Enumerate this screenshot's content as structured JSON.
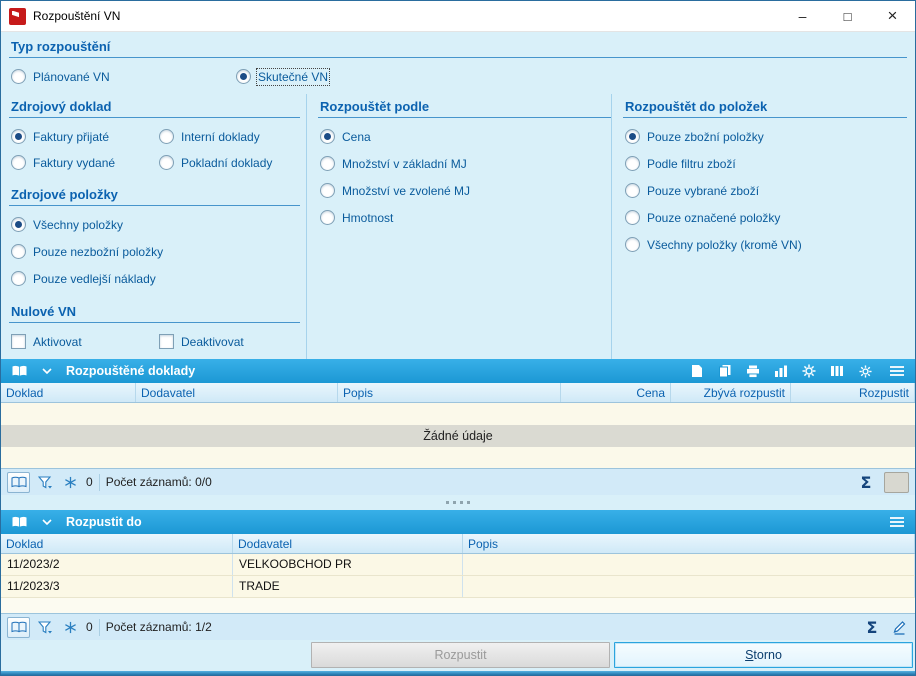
{
  "window": {
    "title": "Rozpouštění VN",
    "controls": {
      "minimize": "–",
      "maximize": "□",
      "close": "×"
    }
  },
  "panel": {
    "typ": {
      "heading": "Typ rozpouštění",
      "options": [
        {
          "label": "Plánované VN",
          "checked": false
        },
        {
          "label": "Skutečné VN",
          "checked": true
        }
      ]
    },
    "zdrojovy_doklad": {
      "heading": "Zdrojový doklad",
      "options": [
        {
          "label": "Faktury přijaté",
          "checked": true
        },
        {
          "label": "Interní doklady",
          "checked": false
        },
        {
          "label": "Faktury vydané",
          "checked": false
        },
        {
          "label": "Pokladní doklady",
          "checked": false
        }
      ]
    },
    "zdrojove_polozky": {
      "heading": "Zdrojové položky",
      "options": [
        {
          "label": "Všechny položky",
          "checked": true
        },
        {
          "label": "Pouze nezbožní položky",
          "checked": false
        },
        {
          "label": "Pouze vedlejší náklady",
          "checked": false
        }
      ]
    },
    "nulove_vn": {
      "heading": "Nulové VN",
      "options": [
        {
          "label": "Aktivovat",
          "checked": false
        },
        {
          "label": "Deaktivovat",
          "checked": false
        }
      ]
    },
    "rozpoustet_podle": {
      "heading": "Rozpouštět podle",
      "options": [
        {
          "label": "Cena",
          "checked": true
        },
        {
          "label": "Množství v základní MJ",
          "checked": false
        },
        {
          "label": "Množství ve zvolené MJ",
          "checked": false
        },
        {
          "label": "Hmotnost",
          "checked": false
        }
      ]
    },
    "rozpoustet_do": {
      "heading": "Rozpouštět do položek",
      "options": [
        {
          "label": "Pouze zbožní položky",
          "checked": true
        },
        {
          "label": "Podle filtru zboží",
          "checked": false
        },
        {
          "label": "Pouze vybrané zboží",
          "checked": false
        },
        {
          "label": "Pouze označené položky",
          "checked": false
        },
        {
          "label": "Všechny položky (kromě VN)",
          "checked": false
        }
      ]
    }
  },
  "grid1": {
    "title": "Rozpouštěné doklady",
    "toolbar_icons": [
      "open-book",
      "chevron-down",
      "new-document",
      "copy",
      "print",
      "chart",
      "actions-gear",
      "columns",
      "settings-gear",
      "menu"
    ],
    "columns": [
      "Doklad",
      "Dodavatel",
      "Popis",
      "Cena",
      "Zbývá rozpustit",
      "Rozpustit"
    ],
    "empty_text": "Žádné údaje",
    "footer": {
      "icons": [
        "view-book",
        "filter",
        "freeze",
        "sum",
        "edit-disabled"
      ],
      "freeze_count": "0",
      "records": "Počet záznamů: 0/0",
      "sum_symbol": "Σ"
    }
  },
  "grid2": {
    "title": "Rozpustit do",
    "toolbar_icons": [
      "open-book",
      "chevron-down",
      "menu"
    ],
    "columns": [
      "Doklad",
      "Dodavatel",
      "Popis"
    ],
    "rows": [
      {
        "doklad": "11/2023/2",
        "dodavatel": "VELKOOBCHOD PR",
        "popis": ""
      },
      {
        "doklad": "11/2023/3",
        "dodavatel": "TRADE",
        "popis": ""
      }
    ],
    "footer": {
      "icons": [
        "view-book",
        "filter",
        "freeze",
        "sum",
        "edit"
      ],
      "freeze_count": "0",
      "records": "Počet záznamů: 1/2",
      "sum_symbol": "Σ"
    }
  },
  "buttons": {
    "rozpustit": "Rozpustit",
    "storno_accel": "S",
    "storno_rest": "torno"
  },
  "colors": {
    "accent_blue": "#0b62b0",
    "bar_blue": "#2aa5e0",
    "background": "#d9f0f9",
    "row_cream": "#fbf8e6",
    "label_blue": "#0a5b9c"
  }
}
